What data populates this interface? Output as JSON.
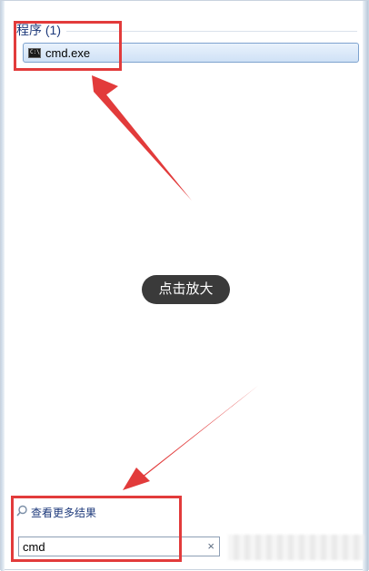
{
  "results": {
    "section_header": "程序 (1)",
    "items": [
      {
        "label": "cmd.exe",
        "icon": "cmd-icon"
      }
    ]
  },
  "overlay": {
    "zoom_label": "点击放大"
  },
  "footer": {
    "see_more_label": "查看更多结果",
    "search_value": "cmd",
    "clear_symbol": "×"
  },
  "annotations": {
    "highlight_color": "#e23b3b"
  }
}
